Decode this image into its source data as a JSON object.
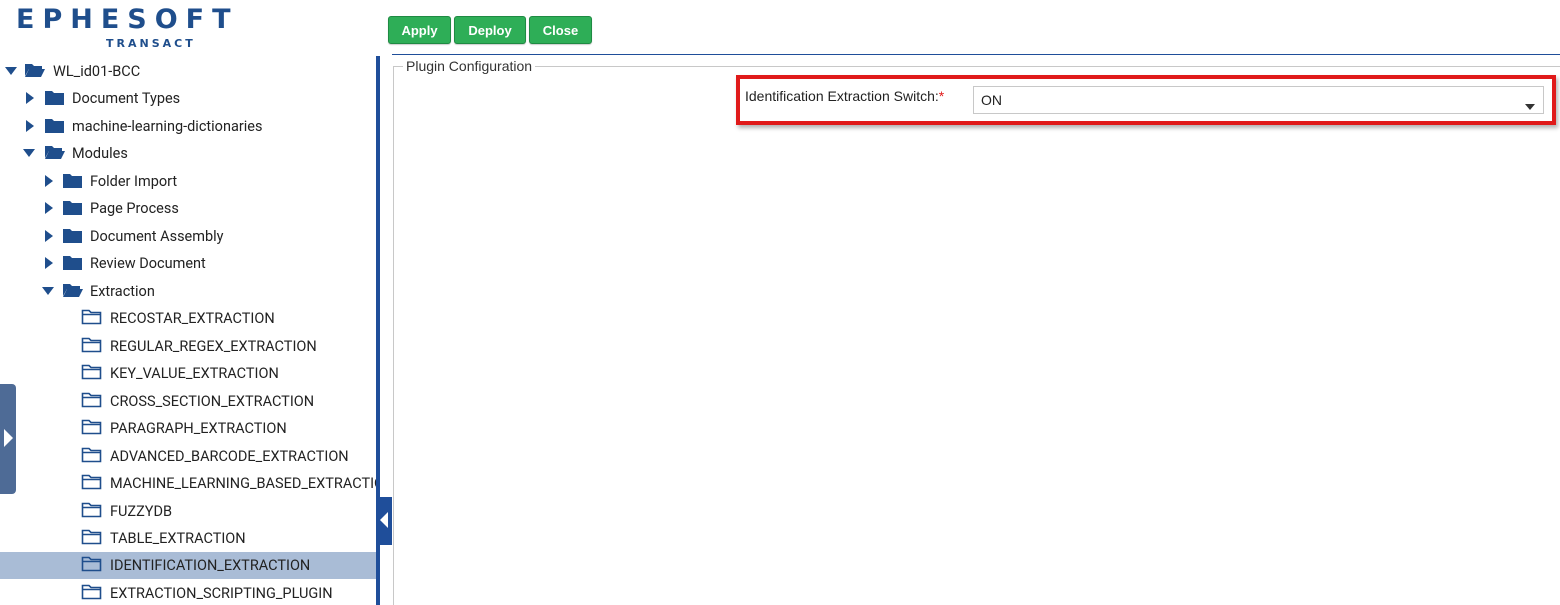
{
  "logo": {
    "main": "EPHESOFT",
    "sub": "TRANSACT"
  },
  "toolbar": {
    "apply_label": "Apply",
    "deploy_label": "Deploy",
    "close_label": "Close"
  },
  "tree": {
    "root": "WL_id01-BCC",
    "document_types": "Document Types",
    "ml_dictionaries": "machine-learning-dictionaries",
    "modules": "Modules",
    "folder_import": "Folder Import",
    "page_process": "Page Process",
    "document_assembly": "Document Assembly",
    "review_document": "Review Document",
    "extraction": "Extraction",
    "plugins": [
      "RECOSTAR_EXTRACTION",
      "REGULAR_REGEX_EXTRACTION",
      "KEY_VALUE_EXTRACTION",
      "CROSS_SECTION_EXTRACTION",
      "PARAGRAPH_EXTRACTION",
      "ADVANCED_BARCODE_EXTRACTION",
      "MACHINE_LEARNING_BASED_EXTRACTION",
      "FUZZYDB",
      "TABLE_EXTRACTION",
      "IDENTIFICATION_EXTRACTION",
      "EXTRACTION_SCRIPTING_PLUGIN"
    ],
    "selected": "IDENTIFICATION_EXTRACTION"
  },
  "config": {
    "legend": "Plugin Configuration",
    "field_label": "Identification Extraction Switch:",
    "required_mark": "*",
    "field_value": "ON"
  },
  "colors": {
    "brand": "#1f4e8c",
    "button": "#2eae57",
    "selection": "#a9bcd6",
    "highlight": "#e01a1a"
  }
}
